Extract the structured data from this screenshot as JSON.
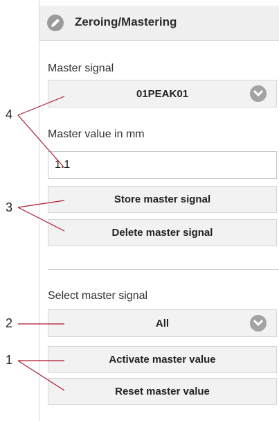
{
  "header": {
    "title": "Zeroing/Mastering",
    "icon": "pencil-icon"
  },
  "master_signal": {
    "label": "Master signal",
    "value": "01PEAK01"
  },
  "master_value": {
    "label": "Master value in mm",
    "value": "1.1"
  },
  "buttons": {
    "store": "Store master signal",
    "delete": "Delete master signal"
  },
  "select_master": {
    "label": "Select master signal",
    "value": "All"
  },
  "actions": {
    "activate": "Activate master value",
    "reset": "Reset master value"
  },
  "callouts": [
    "4",
    "3",
    "2",
    "1"
  ],
  "colors": {
    "callout_line": "#b0172e",
    "chevron": "#a3a3a3",
    "panel_bg": "#f2f2f2"
  }
}
